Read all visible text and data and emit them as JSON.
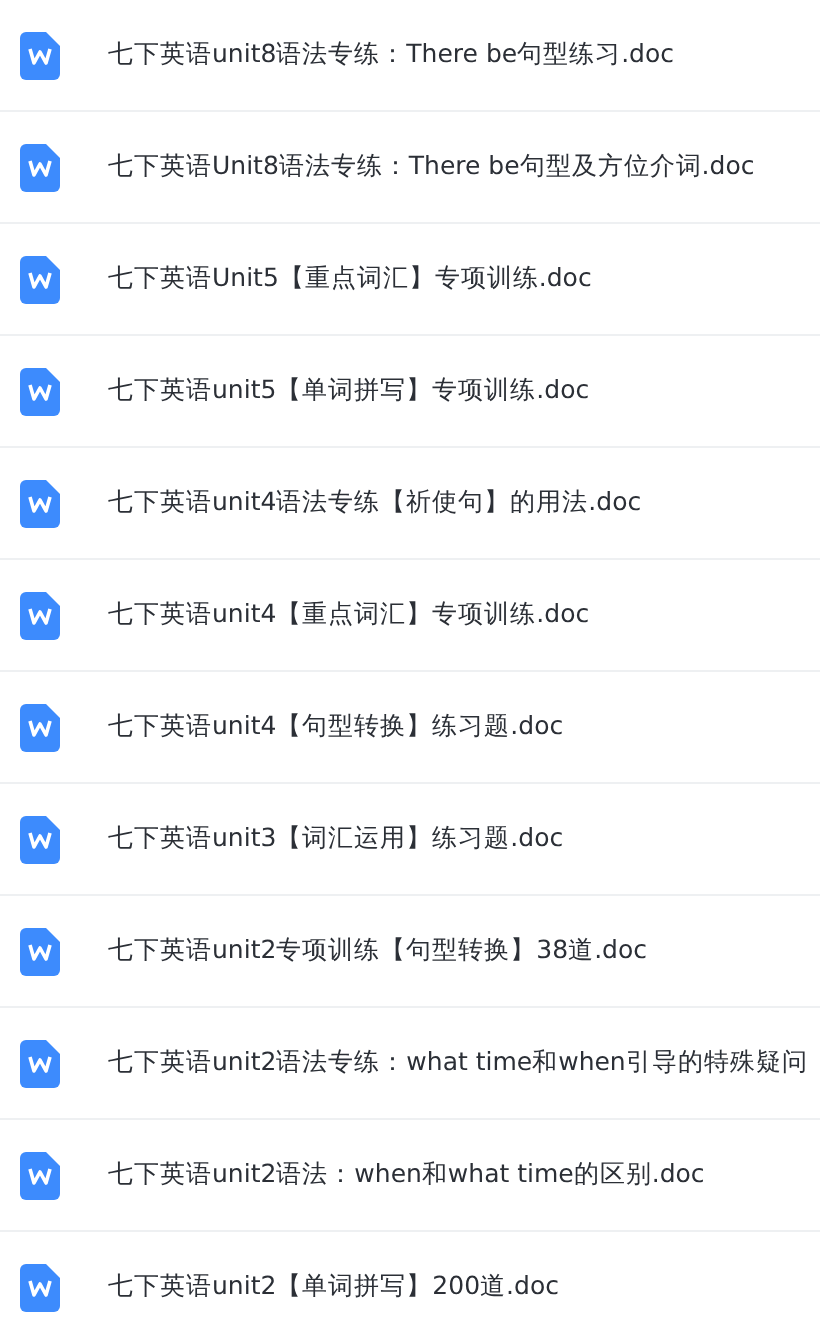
{
  "files": [
    {
      "name": "七下英语unit8语法专练：There be句型练习.doc"
    },
    {
      "name": "七下英语Unit8语法专练：There be句型及方位介词.doc"
    },
    {
      "name": "七下英语Unit5【重点词汇】专项训练.doc"
    },
    {
      "name": "七下英语unit5【单词拼写】专项训练.doc"
    },
    {
      "name": "七下英语unit4语法专练【祈使句】的用法.doc"
    },
    {
      "name": "七下英语unit4【重点词汇】专项训练.doc"
    },
    {
      "name": "七下英语unit4【句型转换】练习题.doc"
    },
    {
      "name": "七下英语unit3【词汇运用】练习题.doc"
    },
    {
      "name": "七下英语unit2专项训练【句型转换】38道.doc"
    },
    {
      "name": "七下英语unit2语法专练：what time和when引导的特殊疑问"
    },
    {
      "name": "七下英语unit2语法：when和what time的区别.doc"
    },
    {
      "name": "七下英语unit2【单词拼写】200道.doc"
    }
  ]
}
